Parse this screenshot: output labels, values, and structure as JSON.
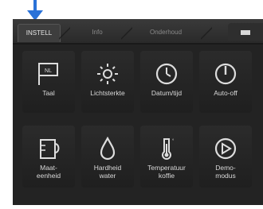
{
  "tabs": [
    {
      "label": "INSTELL"
    },
    {
      "label": "Info"
    },
    {
      "label": "Onderhoud"
    }
  ],
  "tiles": [
    {
      "label": "Taal",
      "badge": "NL",
      "icon": "flag-icon"
    },
    {
      "label": "Lichtsterkte",
      "icon": "brightness-icon"
    },
    {
      "label": "Datum/tijd",
      "icon": "clock-icon"
    },
    {
      "label": "Auto-off",
      "icon": "power-icon"
    },
    {
      "label": "Maat-\neenheid",
      "icon": "measuring-cup-icon"
    },
    {
      "label": "Hardheid\nwater",
      "icon": "water-drop-icon"
    },
    {
      "label": "Temperatuur\nkoffie",
      "icon": "thermometer-icon"
    },
    {
      "label": "Demo-\nmodus",
      "icon": "play-icon"
    }
  ],
  "colors": {
    "arrow": "#2a72d8",
    "screen": "#232323",
    "text": "#d9d9d9"
  }
}
